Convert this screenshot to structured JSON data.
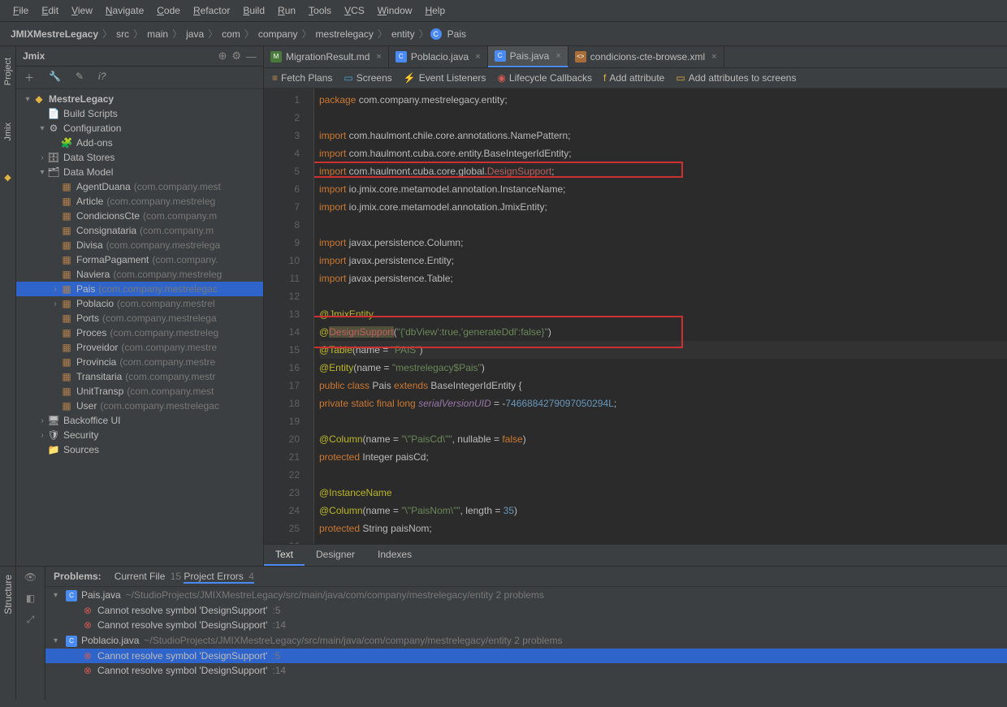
{
  "menubar": [
    "File",
    "Edit",
    "View",
    "Navigate",
    "Code",
    "Refactor",
    "Build",
    "Run",
    "Tools",
    "VCS",
    "Window",
    "Help"
  ],
  "breadcrumb": [
    "JMIXMestreLegacy",
    "src",
    "main",
    "java",
    "com",
    "company",
    "mestrelegacy",
    "entity",
    "Pais"
  ],
  "left_tabs": {
    "project": "Project",
    "jmix": "Jmix",
    "structure": "Structure"
  },
  "jmix": {
    "title": "Jmix",
    "root": "MestreLegacy",
    "items": [
      {
        "label": "Build Scripts",
        "ind": 1,
        "icon": "📄"
      },
      {
        "label": "Configuration",
        "ind": 1,
        "arrow": "▾",
        "icon": "⚙"
      },
      {
        "label": "Add-ons",
        "ind": 2,
        "icon": "🧩"
      },
      {
        "label": "Data Stores",
        "ind": 1,
        "arrow": "›",
        "icon": "🗄"
      },
      {
        "label": "Data Model",
        "ind": 1,
        "arrow": "▾",
        "icon": "🗂"
      },
      {
        "label": "AgentDuana",
        "hint": "(com.company.mest",
        "ind": 2,
        "ent": true
      },
      {
        "label": "Article",
        "hint": "(com.company.mestreleg",
        "ind": 2,
        "ent": true
      },
      {
        "label": "CondicionsCte",
        "hint": "(com.company.m",
        "ind": 2,
        "ent": true
      },
      {
        "label": "Consignataria",
        "hint": "(com.company.m",
        "ind": 2,
        "ent": true
      },
      {
        "label": "Divisa",
        "hint": "(com.company.mestrelega",
        "ind": 2,
        "ent": true
      },
      {
        "label": "FormaPagament",
        "hint": "(com.company.",
        "ind": 2,
        "ent": true
      },
      {
        "label": "Naviera",
        "hint": "(com.company.mestreleg",
        "ind": 2,
        "ent": true
      },
      {
        "label": "Pais",
        "hint": "(com.company.mestrelegac",
        "ind": 2,
        "ent": true,
        "arrow": "›",
        "selected": true
      },
      {
        "label": "Poblacio",
        "hint": "(com.company.mestrel",
        "ind": 2,
        "ent": true,
        "arrow": "›"
      },
      {
        "label": "Ports",
        "hint": "(com.company.mestrelega",
        "ind": 2,
        "ent": true
      },
      {
        "label": "Proces",
        "hint": "(com.company.mestreleg",
        "ind": 2,
        "ent": true
      },
      {
        "label": "Proveidor",
        "hint": "(com.company.mestre",
        "ind": 2,
        "ent": true
      },
      {
        "label": "Provincia",
        "hint": "(com.company.mestre",
        "ind": 2,
        "ent": true
      },
      {
        "label": "Transitaria",
        "hint": "(com.company.mestr",
        "ind": 2,
        "ent": true
      },
      {
        "label": "UnitTransp",
        "hint": "(com.company.mest",
        "ind": 2,
        "ent": true
      },
      {
        "label": "User",
        "hint": "(com.company.mestrelegac",
        "ind": 2,
        "ent": true
      },
      {
        "label": "Backoffice UI",
        "ind": 1,
        "arrow": "›",
        "icon": "🖥"
      },
      {
        "label": "Security",
        "ind": 1,
        "arrow": "›",
        "icon": "🛡"
      },
      {
        "label": "Sources",
        "ind": 1,
        "icon": "📁"
      }
    ]
  },
  "tabs": [
    {
      "label": "MigrationResult.md",
      "icon": "md"
    },
    {
      "label": "Poblacio.java",
      "icon": "java"
    },
    {
      "label": "Pais.java",
      "icon": "java",
      "active": true
    },
    {
      "label": "condicions-cte-browse.xml",
      "icon": "xml"
    }
  ],
  "toolbar2": [
    {
      "label": "Fetch Plans",
      "color": "#c98f4a",
      "ic": "≡"
    },
    {
      "label": "Screens",
      "color": "#4aa0d0",
      "ic": "▭"
    },
    {
      "label": "Event Listeners",
      "color": "#e0b341",
      "ic": "⚡"
    },
    {
      "label": "Lifecycle Callbacks",
      "color": "#cf5b56",
      "ic": "◉"
    },
    {
      "label": "Add attribute",
      "color": "#e0b341",
      "ic": "f"
    },
    {
      "label": "Add attributes to screens",
      "color": "#e0b341",
      "ic": "▭"
    }
  ],
  "code": {
    "lines": [
      {
        "n": 1,
        "h": "<span class='kw'>package</span> com.company.mestrelegacy.entity;"
      },
      {
        "n": 2,
        "h": ""
      },
      {
        "n": 3,
        "h": "<span class='kw'>import</span> com.haulmont.chile.core.annotations.NamePattern;"
      },
      {
        "n": 4,
        "h": "<span class='kw'>import</span> com.haulmont.cuba.core.entity.BaseIntegerIdEntity;"
      },
      {
        "n": 5,
        "h": "<span class='kw'>import</span> com.haulmont.cuba.core.global.<span class='err'>DesignSupport</span>;"
      },
      {
        "n": 6,
        "h": "<span class='kw'>import</span> io.jmix.core.metamodel.annotation.InstanceName;"
      },
      {
        "n": 7,
        "h": "<span class='kw'>import</span> io.jmix.core.metamodel.annotation.JmixEntity;"
      },
      {
        "n": 8,
        "h": ""
      },
      {
        "n": 9,
        "h": "<span class='kw'>import</span> javax.persistence.Column;"
      },
      {
        "n": 10,
        "h": "<span class='kw'>import</span> javax.persistence.Entity;"
      },
      {
        "n": 11,
        "h": "<span class='kw'>import</span> javax.persistence.Table;"
      },
      {
        "n": 12,
        "h": ""
      },
      {
        "n": 13,
        "h": "<span class='ann'>@JmixEntity</span>"
      },
      {
        "n": 14,
        "h": "<span class='ann'>@</span><span class='err' style='background:#52503a'>DesignSupport</span>(<span class='str'>\"{'dbView':true,'generateDdl':false}\"</span>)"
      },
      {
        "n": 15,
        "h": "<span class='ann'>@Table</span>(name = <span class='str'>\"PAIS\"</span>)",
        "cur": true
      },
      {
        "n": 16,
        "h": "<span class='ann'>@Entity</span>(name = <span class='str'>\"mestrelegacy$Pais\"</span>)"
      },
      {
        "n": 17,
        "h": "<span class='kw'>public class</span> Pais <span class='kw'>extends</span> BaseIntegerIdEntity {"
      },
      {
        "n": 18,
        "h": "    <span class='kw'>private static final long</span> <span class='field'>serialVersionUID</span> = -<span class='num'>7466884279097050294L</span>;"
      },
      {
        "n": 19,
        "h": ""
      },
      {
        "n": 20,
        "h": "    <span class='ann'>@Column</span>(name = <span class='str'>\"\\\"PaisCd\\\"\"</span>, nullable = <span class='kw'>false</span>)"
      },
      {
        "n": 21,
        "h": "    <span class='kw'>protected</span> Integer paisCd;"
      },
      {
        "n": 22,
        "h": ""
      },
      {
        "n": 23,
        "h": "    <span class='ann'>@InstanceName</span>"
      },
      {
        "n": 24,
        "h": "    <span class='ann'>@Column</span>(name = <span class='str'>\"\\\"PaisNom\\\"\"</span>, length = <span class='num'>35</span>)"
      },
      {
        "n": 25,
        "h": "    <span class='kw'>protected</span> String paisNom;"
      },
      {
        "n": 26,
        "h": ""
      }
    ]
  },
  "bottom_tabs": [
    "Text",
    "Designer",
    "Indexes"
  ],
  "problems": {
    "title": "Problems:",
    "tabs": [
      {
        "label": "Current File",
        "cnt": "15"
      },
      {
        "label": "Project Errors",
        "cnt": "4",
        "active": true
      }
    ],
    "rows": [
      {
        "arrow": "▾",
        "icon": "java",
        "label": "Pais.java",
        "hint": "~/StudioProjects/JMIXMestreLegacy/src/main/java/com/company/mestrelegacy/entity  2 problems"
      },
      {
        "err": true,
        "label": "Cannot resolve symbol 'DesignSupport'",
        "hint": ":5"
      },
      {
        "err": true,
        "label": "Cannot resolve symbol 'DesignSupport'",
        "hint": ":14"
      },
      {
        "arrow": "▾",
        "icon": "java",
        "label": "Poblacio.java",
        "hint": "~/StudioProjects/JMIXMestreLegacy/src/main/java/com/company/mestrelegacy/entity  2 problems"
      },
      {
        "err": true,
        "label": "Cannot resolve symbol 'DesignSupport'",
        "hint": ":5",
        "sel": true
      },
      {
        "err": true,
        "label": "Cannot resolve symbol 'DesignSupport'",
        "hint": ":14"
      }
    ]
  }
}
